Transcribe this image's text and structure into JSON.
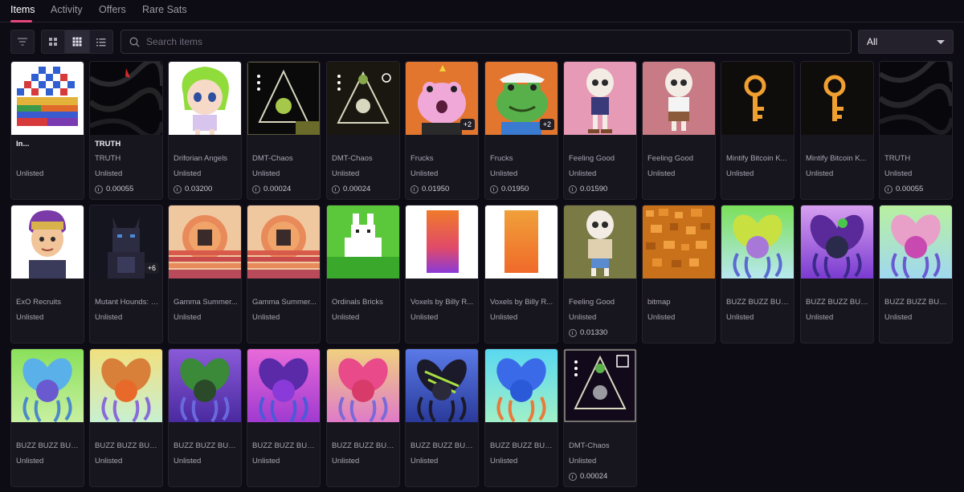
{
  "tabs": [
    {
      "label": "Items",
      "active": true
    },
    {
      "label": "Activity",
      "active": false
    },
    {
      "label": "Offers",
      "active": false
    },
    {
      "label": "Rare Sats",
      "active": false
    }
  ],
  "toolbar": {
    "filter_icon": "filter-icon",
    "view_large_icon": "grid-large-icon",
    "view_small_icon": "grid-small-icon",
    "view_list_icon": "list-icon",
    "search_placeholder": "Search items",
    "select_value": "All"
  },
  "colors": {
    "accent": "#e8467c",
    "background": "#0d0b13",
    "card": "#17151e"
  },
  "items": [
    {
      "name": "In...",
      "collection": "",
      "status": "Unlisted",
      "price": "",
      "badge": ""
    },
    {
      "name": "TRUTH",
      "collection": "TRUTH",
      "status": "Unlisted",
      "price": "0.00055",
      "badge": ""
    },
    {
      "name": "",
      "collection": "Driforian Angels",
      "status": "Unlisted",
      "price": "0.03200",
      "badge": ""
    },
    {
      "name": "",
      "collection": "DMT-Chaos",
      "status": "Unlisted",
      "price": "0.00024",
      "badge": ""
    },
    {
      "name": "",
      "collection": "DMT-Chaos",
      "status": "Unlisted",
      "price": "0.00024",
      "badge": ""
    },
    {
      "name": "",
      "collection": "Frucks",
      "status": "Unlisted",
      "price": "0.01950",
      "badge": "+2"
    },
    {
      "name": "",
      "collection": "Frucks",
      "status": "Unlisted",
      "price": "0.01950",
      "badge": "+2"
    },
    {
      "name": "",
      "collection": "Feeling Good",
      "status": "Unlisted",
      "price": "0.01590",
      "badge": ""
    },
    {
      "name": "",
      "collection": "Feeling Good",
      "status": "Unlisted",
      "price": "",
      "badge": ""
    },
    {
      "name": "",
      "collection": "Mintify Bitcoin K...",
      "status": "Unlisted",
      "price": "",
      "badge": ""
    },
    {
      "name": "",
      "collection": "Mintify Bitcoin K...",
      "status": "Unlisted",
      "price": "",
      "badge": ""
    },
    {
      "name": "",
      "collection": "TRUTH",
      "status": "Unlisted",
      "price": "0.00055",
      "badge": ""
    },
    {
      "name": "",
      "collection": "ExO Recruits",
      "status": "Unlisted",
      "price": "",
      "badge": ""
    },
    {
      "name": "",
      "collection": "Mutant Hounds: I...",
      "status": "Unlisted",
      "price": "",
      "badge": "+6"
    },
    {
      "name": "",
      "collection": "Gamma Summer...",
      "status": "Unlisted",
      "price": "",
      "badge": ""
    },
    {
      "name": "",
      "collection": "Gamma Summer...",
      "status": "Unlisted",
      "price": "",
      "badge": ""
    },
    {
      "name": "",
      "collection": "Ordinals Bricks",
      "status": "Unlisted",
      "price": "",
      "badge": ""
    },
    {
      "name": "",
      "collection": "Voxels by Billy R...",
      "status": "Unlisted",
      "price": "",
      "badge": ""
    },
    {
      "name": "",
      "collection": "Voxels by Billy R...",
      "status": "Unlisted",
      "price": "",
      "badge": ""
    },
    {
      "name": "",
      "collection": "Feeling Good",
      "status": "Unlisted",
      "price": "0.01330",
      "badge": ""
    },
    {
      "name": "",
      "collection": "bitmap",
      "status": "Unlisted",
      "price": "",
      "badge": ""
    },
    {
      "name": "",
      "collection": "BUZZ BUZZ BUZ...",
      "status": "Unlisted",
      "price": "",
      "badge": ""
    },
    {
      "name": "",
      "collection": "BUZZ BUZZ BUZ...",
      "status": "Unlisted",
      "price": "",
      "badge": ""
    },
    {
      "name": "",
      "collection": "BUZZ BUZZ BUZ...",
      "status": "Unlisted",
      "price": "",
      "badge": ""
    },
    {
      "name": "",
      "collection": "BUZZ BUZZ BUZ...",
      "status": "Unlisted",
      "price": "",
      "badge": ""
    },
    {
      "name": "",
      "collection": "BUZZ BUZZ BUZ...",
      "status": "Unlisted",
      "price": "",
      "badge": ""
    },
    {
      "name": "",
      "collection": "BUZZ BUZZ BUZ...",
      "status": "Unlisted",
      "price": "",
      "badge": ""
    },
    {
      "name": "",
      "collection": "BUZZ BUZZ BUZ...",
      "status": "Unlisted",
      "price": "",
      "badge": ""
    },
    {
      "name": "",
      "collection": "BUZZ BUZZ BUZ...",
      "status": "Unlisted",
      "price": "",
      "badge": ""
    },
    {
      "name": "",
      "collection": "BUZZ BUZZ BUZ...",
      "status": "Unlisted",
      "price": "",
      "badge": ""
    },
    {
      "name": "",
      "collection": "BUZZ BUZZ BUZ...",
      "status": "Unlisted",
      "price": "",
      "badge": ""
    },
    {
      "name": "",
      "collection": "DMT-Chaos",
      "status": "Unlisted",
      "price": "0.00024",
      "badge": ""
    }
  ]
}
